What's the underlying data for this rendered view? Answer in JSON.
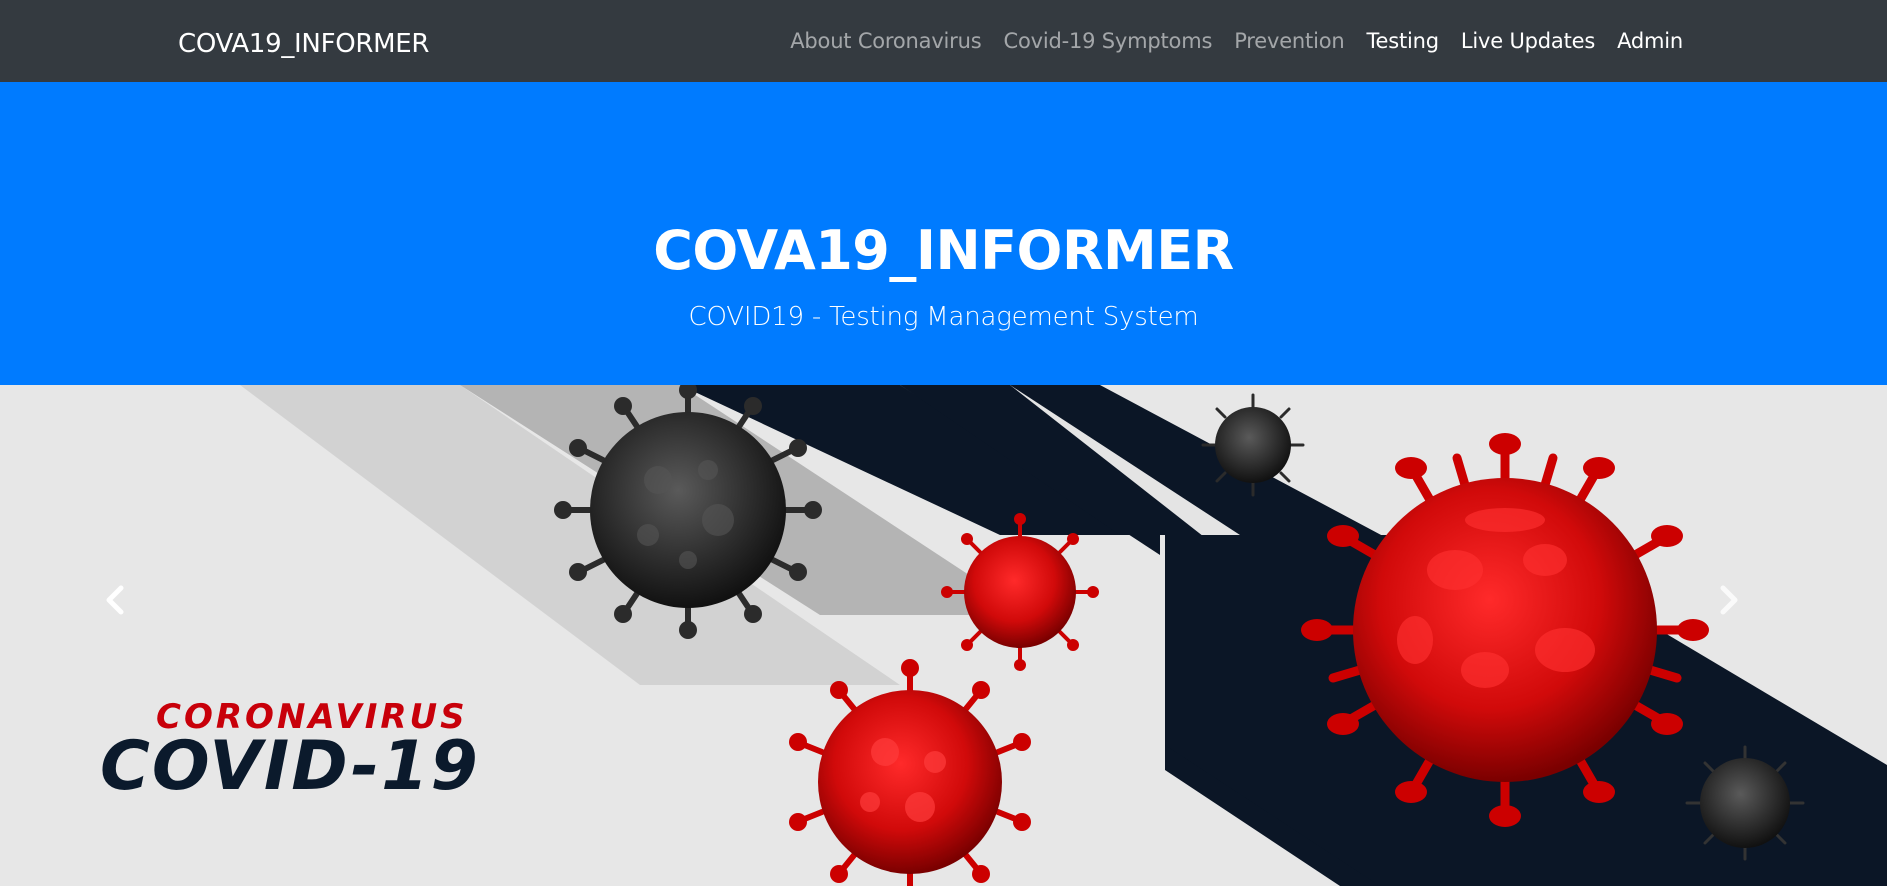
{
  "navbar": {
    "brand": "COVA19_INFORMER",
    "links": [
      {
        "label": "About Coronavirus"
      },
      {
        "label": "Covid-19 Symptoms"
      },
      {
        "label": "Prevention"
      },
      {
        "label": "Testing"
      },
      {
        "label": "Live Updates"
      },
      {
        "label": "Admin"
      }
    ]
  },
  "hero": {
    "title": "COVA19_INFORMER",
    "subtitle": "COVID19 - Testing Management System"
  },
  "carousel": {
    "banner_line1": "CORONAVIRUS",
    "banner_line2": "COVID-19",
    "prev_icon": "chevron-left-icon",
    "next_icon": "chevron-right-icon"
  },
  "colors": {
    "navbar_bg": "#343a40",
    "hero_bg": "#007bff",
    "virus_red": "#d10a0a",
    "virus_dark": "#2a2a2a",
    "stripe_navy": "#0b1626"
  }
}
